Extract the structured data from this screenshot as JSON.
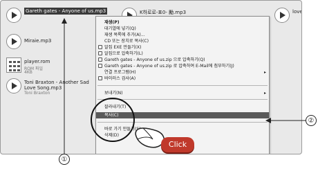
{
  "files": [
    {
      "name": "Gareth gates - Anyone of us.mp3",
      "sub": "",
      "selected": true
    },
    {
      "name": "Miraie.mp3",
      "sub": ""
    },
    {
      "name": "player.rom",
      "sub": "ROM 파일",
      "sub2": "4KB"
    },
    {
      "name": "Toni Braxton - Another Sad Love Song.mp3",
      "sub": "Toni Braxton"
    },
    {
      "name": "K하로로-표0- 勵.mp3",
      "sub": ""
    },
    {
      "name": "lovers",
      "sub": ""
    }
  ],
  "menu": {
    "items": [
      {
        "label": "재생(P)",
        "bold": true
      },
      {
        "label": "대기열에 넣기(Q)"
      },
      {
        "label": "재생 목록에 추가(A)..."
      },
      {
        "label": "CD 또는 장치로 복사(C)"
      },
      {
        "label": "알집 EXE 만들기(X)",
        "icon": true
      },
      {
        "label": "알집으로 압축하기(L)",
        "icon": true
      },
      {
        "label": "Gareth gates - Anyone of us.zip 으로 압축하기(Q)",
        "icon": true
      },
      {
        "label": "Gareth gates - Anyone of us.zip 로 압축하여 E-Mail에 첨부하기(J)",
        "icon": true
      },
      {
        "label": "연결 프로그램(H)",
        "arrow": "▸"
      },
      {
        "label": "바이러스 검사(A)",
        "icon": true
      },
      {
        "label": "보내기(N)",
        "arrow": "▸"
      },
      {
        "label": "잘라내기(T)"
      },
      {
        "label": "복사(C)",
        "highlighted": true
      },
      {
        "label": "바로 가기 만들기(S)"
      },
      {
        "label": "삭제(D)"
      }
    ]
  },
  "annotations": {
    "marker1": "①",
    "marker2": "②",
    "click_label": "Click"
  }
}
